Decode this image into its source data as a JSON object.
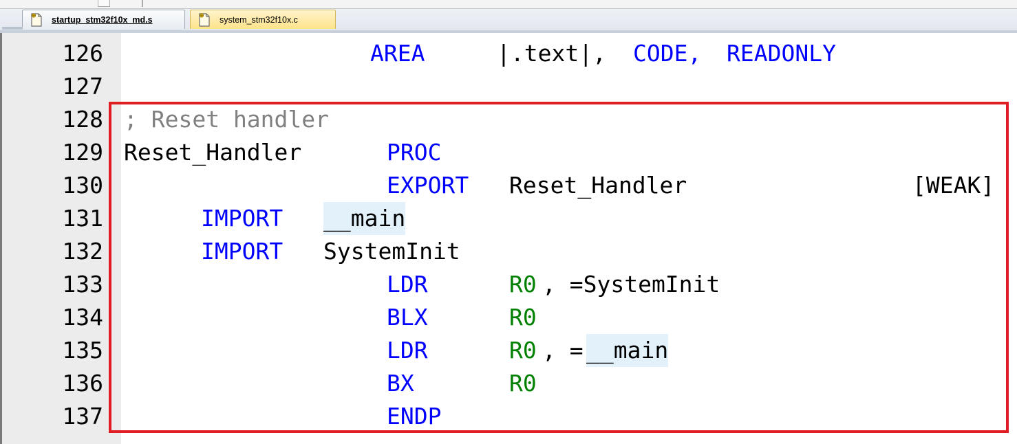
{
  "tabs": [
    {
      "label": "startup_stm32f10x_md.s",
      "active": true
    },
    {
      "label": "system_stm32f10x.c",
      "active": false
    }
  ],
  "editor": {
    "lines": [
      {
        "number": "126",
        "tokens": [
          {
            "text": "AREA",
            "type": "keyword"
          },
          {
            "text": "|.text|,",
            "type": "text"
          },
          {
            "text": "CODE,",
            "type": "keyword"
          },
          {
            "text": "READONLY",
            "type": "keyword"
          }
        ]
      },
      {
        "number": "127",
        "tokens": []
      },
      {
        "number": "128",
        "tokens": [
          {
            "text": "; Reset handler",
            "type": "comment"
          }
        ]
      },
      {
        "number": "129",
        "tokens": [
          {
            "text": "Reset_Handler",
            "type": "text"
          },
          {
            "text": "PROC",
            "type": "keyword"
          }
        ]
      },
      {
        "number": "130",
        "tokens": [
          {
            "text": "EXPORT",
            "type": "keyword"
          },
          {
            "text": "Reset_Handler",
            "type": "text"
          },
          {
            "text": "[WEAK]",
            "type": "text"
          }
        ]
      },
      {
        "number": "131",
        "tokens": [
          {
            "text": "IMPORT",
            "type": "keyword"
          },
          {
            "text": "__main",
            "type": "text"
          }
        ]
      },
      {
        "number": "132",
        "tokens": [
          {
            "text": "IMPORT",
            "type": "keyword"
          },
          {
            "text": "SystemInit",
            "type": "text"
          }
        ]
      },
      {
        "number": "133",
        "tokens": [
          {
            "text": "LDR",
            "type": "keyword"
          },
          {
            "text": "R0",
            "type": "register"
          },
          {
            "text": ", =SystemInit",
            "type": "text"
          }
        ]
      },
      {
        "number": "134",
        "tokens": [
          {
            "text": "BLX",
            "type": "keyword"
          },
          {
            "text": "R0",
            "type": "register"
          }
        ]
      },
      {
        "number": "135",
        "tokens": [
          {
            "text": "LDR",
            "type": "keyword"
          },
          {
            "text": "R0",
            "type": "register"
          },
          {
            "text": ", =",
            "type": "text"
          },
          {
            "text": "__main",
            "type": "text"
          }
        ]
      },
      {
        "number": "136",
        "tokens": [
          {
            "text": "BX",
            "type": "keyword"
          },
          {
            "text": "R0",
            "type": "register"
          }
        ]
      },
      {
        "number": "137",
        "tokens": [
          {
            "text": "ENDP",
            "type": "keyword"
          }
        ]
      }
    ],
    "colors": {
      "keyword": "#0000ff",
      "text": "#000000",
      "comment": "#808080",
      "register": "#008000",
      "word_highlight": "#e3f1fb",
      "annotation_box": "#e01c24",
      "gutter": "#ececec"
    },
    "icons": {
      "tab_file": "assembly-file-icon"
    }
  }
}
